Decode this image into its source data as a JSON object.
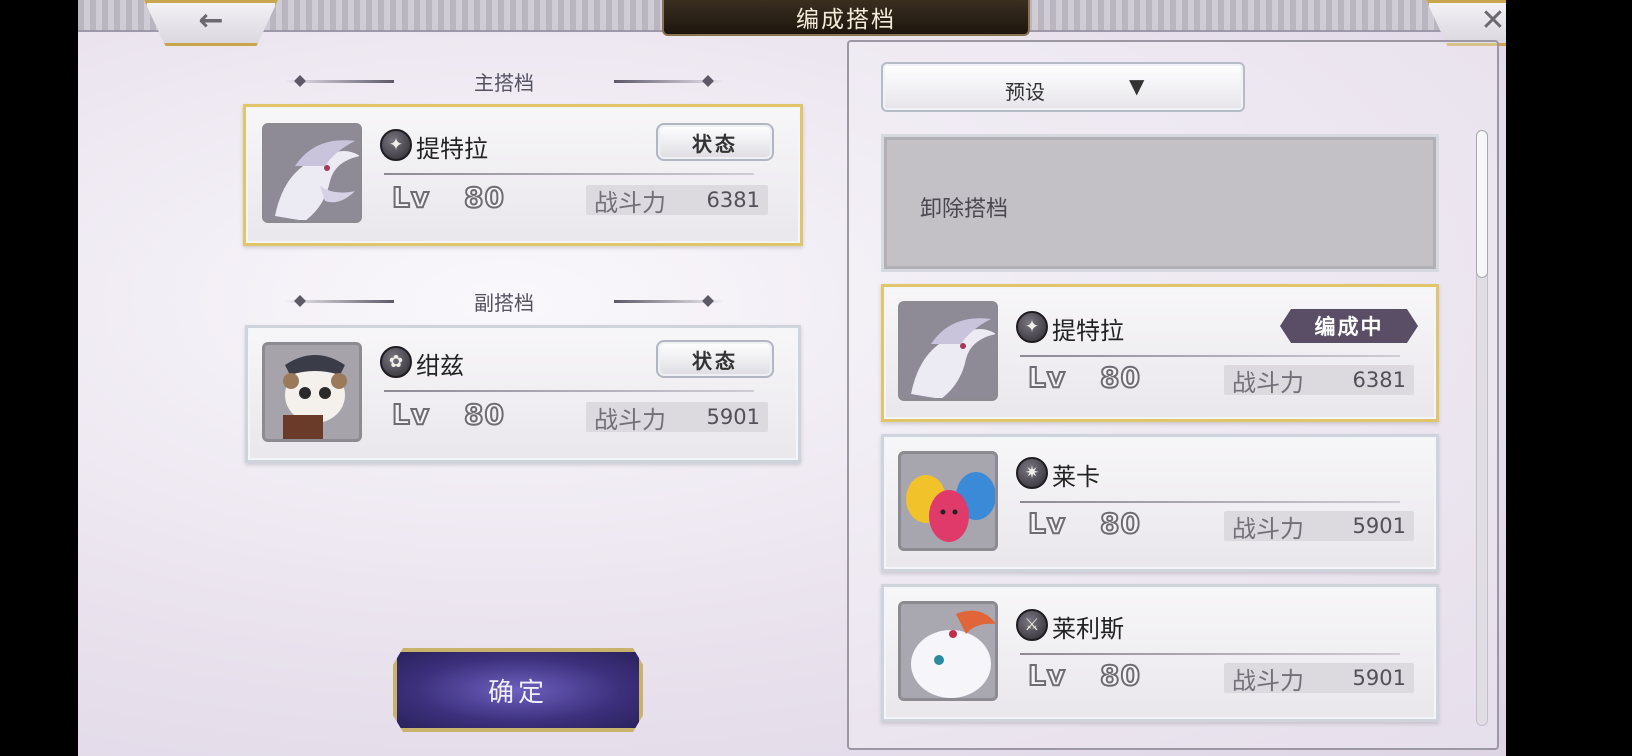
{
  "header": {
    "title": "编成搭档",
    "back_icon": "arrow-left-icon",
    "close_icon": "close-icon"
  },
  "left": {
    "main_section_label": "主搭档",
    "sub_section_label": "副搭档",
    "main_partner": {
      "name": "提特拉",
      "element_icon": "star-element-icon",
      "status_label": "状态",
      "lv_label": "Lv",
      "level": "80",
      "power_label": "战斗力",
      "power": "6381"
    },
    "sub_partner": {
      "name": "绀兹",
      "element_icon": "spiral-element-icon",
      "status_label": "状态",
      "lv_label": "Lv",
      "level": "80",
      "power_label": "战斗力",
      "power": "5901"
    },
    "confirm_label": "确定"
  },
  "right": {
    "preset_label": "预设",
    "remove_label": "卸除搭档",
    "list": [
      {
        "name": "提特拉",
        "badge": "编成中",
        "lv_label": "Lv",
        "level": "80",
        "power_label": "战斗力",
        "power": "6381"
      },
      {
        "name": "莱卡",
        "badge": "",
        "lv_label": "Lv",
        "level": "80",
        "power_label": "战斗力",
        "power": "5901"
      },
      {
        "name": "莱利斯",
        "badge": "",
        "lv_label": "Lv",
        "level": "80",
        "power_label": "战斗力",
        "power": "5901"
      }
    ]
  },
  "colors": {
    "gold_border": "#e0c56a",
    "badge_bg": "#5a4d66",
    "confirm_bg": "#3c307c"
  }
}
